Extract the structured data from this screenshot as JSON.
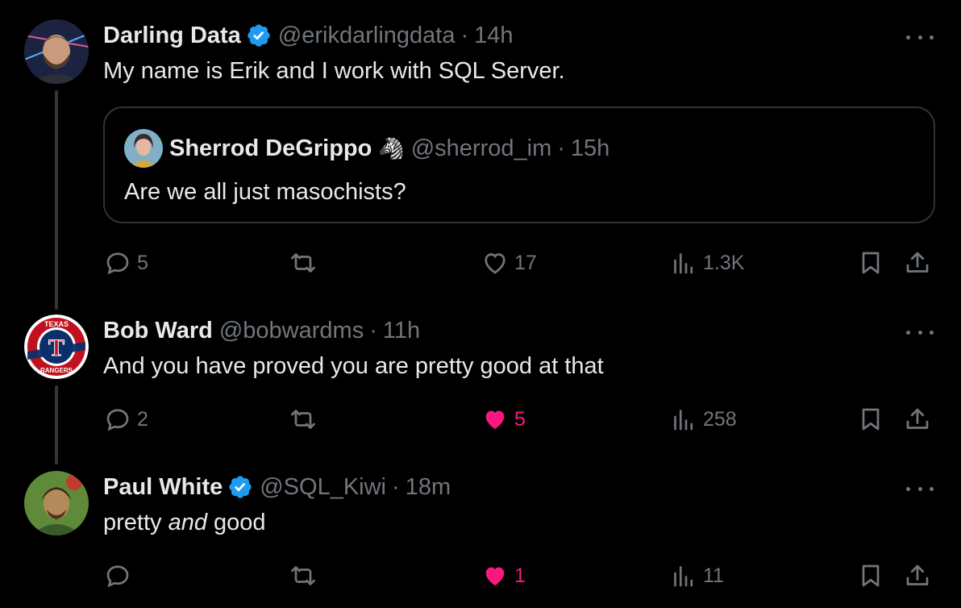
{
  "tweets": [
    {
      "name": "Darling Data",
      "verified": true,
      "handle": "@erikdarlingdata",
      "separator": "·",
      "time": "14h",
      "text": "My name is Erik and I work with SQL Server.",
      "quote": {
        "name": "Sherrod DeGrippo",
        "emoji": "🦓",
        "handle": "@sherrod_im",
        "separator": "·",
        "time": "15h",
        "text": "Are we all just masochists?"
      },
      "actions": {
        "replies": "5",
        "reposts": "",
        "likes": "17",
        "liked": false,
        "views": "1.3K"
      }
    },
    {
      "name": "Bob Ward",
      "verified": false,
      "handle": "@bobwardms",
      "separator": "·",
      "time": "11h",
      "text": "And you have proved you are pretty good at that",
      "avatar_text": {
        "top": "TEXAS",
        "bottom": "RANGERS",
        "center": "T"
      },
      "actions": {
        "replies": "2",
        "reposts": "",
        "likes": "5",
        "liked": true,
        "views": "258"
      }
    },
    {
      "name": "Paul White",
      "verified": true,
      "handle": "@SQL_Kiwi",
      "separator": "·",
      "time": "18m",
      "text_before": "pretty ",
      "text_em": "and",
      "text_after": " good",
      "actions": {
        "replies": "",
        "reposts": "",
        "likes": "1",
        "liked": true,
        "views": "11"
      }
    }
  ],
  "colors": {
    "background": "#000000",
    "text": "#e7e9ea",
    "muted": "#71767b",
    "verified": "#1d9bf0",
    "like": "#f91880",
    "border": "#2f3336"
  },
  "icons": [
    "reply-icon",
    "repost-icon",
    "like-icon",
    "views-icon",
    "bookmark-icon",
    "share-icon",
    "more-icon",
    "verified-badge-icon"
  ]
}
